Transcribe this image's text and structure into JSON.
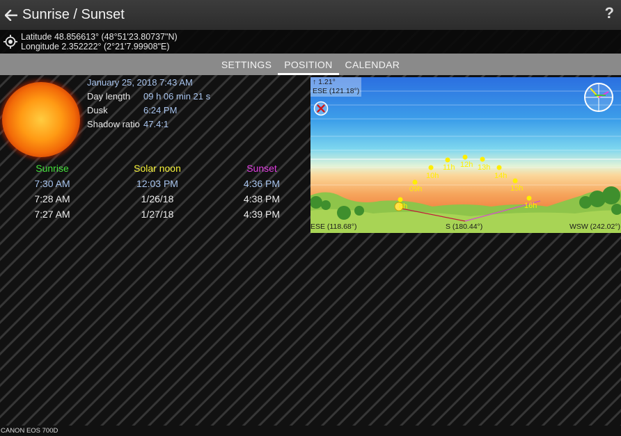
{
  "app": {
    "title": "Sunrise / Sunset",
    "help": "?"
  },
  "location": {
    "latitude": "Latitude 48.856613° (48°51'23.80737\"N)",
    "longitude": "Longitude 2.352222° (2°21'7.99908\"E)"
  },
  "tabs": [
    {
      "label": "SETTINGS",
      "active": false
    },
    {
      "label": "POSITION",
      "active": true
    },
    {
      "label": "CALENDAR",
      "active": false
    }
  ],
  "info": {
    "datetime": "January 25, 2018 7:43 AM",
    "day_length_label": "Day length",
    "day_length": "09 h 06 min 21 s",
    "dusk_label": "Dusk",
    "dusk": "6:24 PM",
    "shadow_label": "Shadow ratio",
    "shadow": "47.4:1"
  },
  "times": {
    "headers": [
      "Sunrise",
      "Solar noon",
      "Sunset"
    ],
    "rows": [
      [
        "7:30 AM",
        "12:03 PM",
        "4:36 PM"
      ],
      [
        "7:28 AM",
        "1/26/18",
        "4:38 PM"
      ],
      [
        "7:27 AM",
        "1/27/18",
        "4:39 PM"
      ]
    ]
  },
  "sky_view": {
    "elevation": "↑ 1.21°",
    "direction_top": "ESE (121.18°)",
    "left_azimuth": "ESE (118.68°)",
    "center_azimuth": "S (180.44°)",
    "right_azimuth": "WSW (242.02°)",
    "hour_labels": [
      "8h",
      "09h",
      "10h",
      "11h",
      "12h",
      "13h",
      "14h",
      "15h",
      "16h"
    ]
  },
  "footer": {
    "camera": "CANON EOS 700D"
  }
}
